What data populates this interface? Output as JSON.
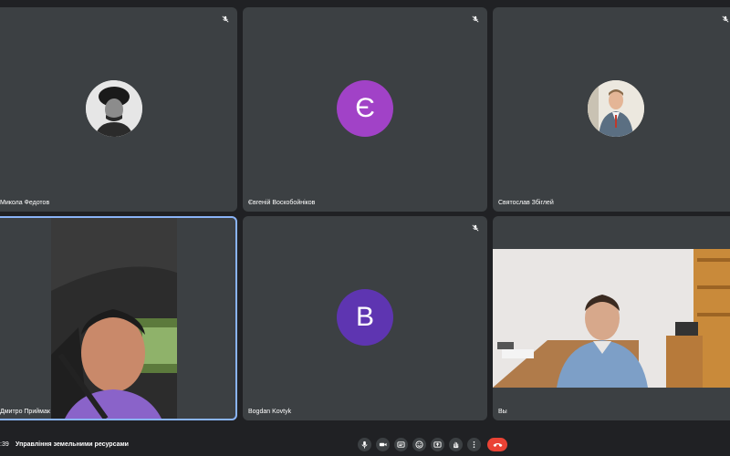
{
  "participants": [
    {
      "name": "Микола Федотов"
    },
    {
      "name": "Євгеній Воскобойніков",
      "initial": "Є",
      "avatar_color": "#a142c7"
    },
    {
      "name": "Святослав Збіглей"
    },
    {
      "name": "Дмитро Приймак"
    },
    {
      "name": "Bogdan Kovtyk",
      "initial": "B",
      "avatar_color": "#5e35b1"
    },
    {
      "name": "Вы"
    }
  ],
  "meeting": {
    "time": ":39",
    "title": "Управління земельними ресурсами"
  },
  "controls": [
    {
      "icon": "microphone-icon"
    },
    {
      "icon": "camera-icon"
    },
    {
      "icon": "captions-icon"
    },
    {
      "icon": "emoji-icon"
    },
    {
      "icon": "present-screen-icon"
    },
    {
      "icon": "raise-hand-icon"
    },
    {
      "icon": "more-options-icon"
    },
    {
      "icon": "end-call-icon"
    }
  ],
  "colors": {
    "background": "#202124",
    "tile": "#3c4043",
    "active_border": "#8ab4f8",
    "end_call": "#ea4335"
  }
}
